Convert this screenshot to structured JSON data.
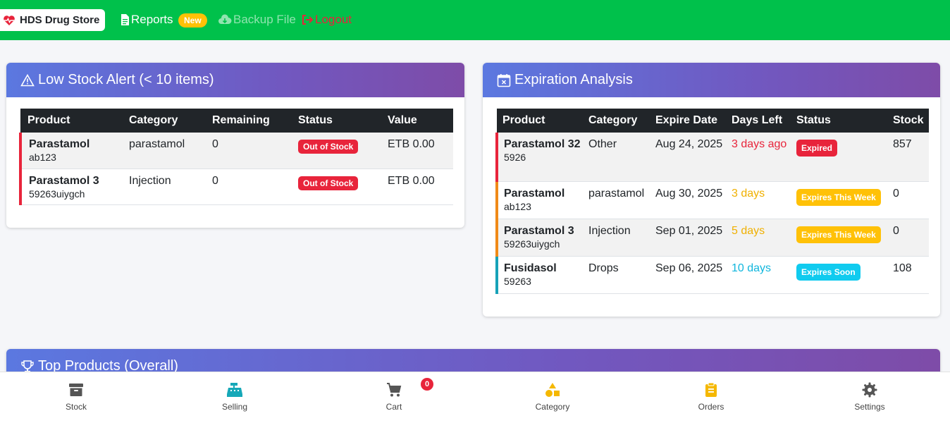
{
  "navbar": {
    "brand": "HDS Drug Store",
    "reports": "Reports",
    "new_badge": "New",
    "backup": "Backup File",
    "logout": "Logout",
    "colors": {
      "bar": "#00c14b",
      "logout": "#e8243b",
      "new": "#ffc107"
    }
  },
  "low_stock": {
    "title": "Low Stock Alert (< 10 items)",
    "columns": [
      "Product",
      "Category",
      "Remaining",
      "Status",
      "Value"
    ],
    "rows": [
      {
        "name": "Parastamol",
        "code": "ab123",
        "category": "parastamol",
        "remaining": "0",
        "status": "Out of Stock",
        "value": "ETB 0.00"
      },
      {
        "name": "Parastamol 3",
        "code": "59263uiygch",
        "category": "Injection",
        "remaining": "0",
        "status": "Out of Stock",
        "value": "ETB 0.00"
      }
    ]
  },
  "expiration": {
    "title": "Expiration Analysis",
    "columns": [
      "Product",
      "Category",
      "Expire Date",
      "Days Left",
      "Status",
      "Stock"
    ],
    "rows": [
      {
        "name": "Parastamol 32",
        "code": "5926",
        "category": "Other",
        "expire": "Aug 24, 2025",
        "days": "3 days ago",
        "status": "Expired",
        "stock": "857"
      },
      {
        "name": "Parastamol",
        "code": "ab123",
        "category": "parastamol",
        "expire": "Aug 30, 2025",
        "days": "3 days",
        "status": "Expires This Week",
        "stock": "0"
      },
      {
        "name": "Parastamol 3",
        "code": "59263uiygch",
        "category": "Injection",
        "expire": "Sep 01, 2025",
        "days": "5 days",
        "status": "Expires This Week",
        "stock": "0"
      },
      {
        "name": "Fusidasol",
        "code": "59263",
        "category": "Drops",
        "expire": "Sep 06, 2025",
        "days": "10 days",
        "status": "Expires Soon",
        "stock": "108"
      }
    ]
  },
  "top_products": {
    "title": "Top Products (Overall)"
  },
  "bottom_nav": {
    "items": [
      {
        "label": "Stock",
        "icon": "archive-icon"
      },
      {
        "label": "Selling",
        "icon": "cash-register-icon"
      },
      {
        "label": "Cart",
        "icon": "cart-icon"
      },
      {
        "label": "Category",
        "icon": "shapes-icon"
      },
      {
        "label": "Orders",
        "icon": "clipboard-icon"
      },
      {
        "label": "Settings",
        "icon": "gear-icon"
      }
    ],
    "cart_count": "0"
  }
}
